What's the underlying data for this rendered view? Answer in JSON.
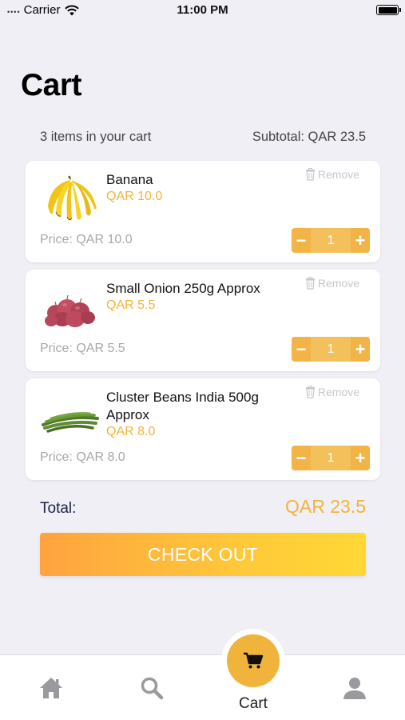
{
  "status_bar": {
    "carrier": "Carrier",
    "time": "11:00 PM",
    "signal": "••••"
  },
  "header": {
    "title": "Cart"
  },
  "summary": {
    "items_count": "3 items in your cart",
    "subtotal": "Subtotal: QAR 23.5"
  },
  "items": [
    {
      "name": "Banana",
      "price": "QAR 10.0",
      "price_label": "Price: QAR 10.0",
      "qty": "1",
      "remove": "Remove",
      "image": "banana-image"
    },
    {
      "name": "Small Onion 250g Approx",
      "price": "QAR 5.5",
      "price_label": "Price: QAR 5.5",
      "qty": "1",
      "remove": "Remove",
      "image": "onion-image"
    },
    {
      "name": "Cluster Beans India 500g Approx",
      "price": "QAR 8.0",
      "price_label": "Price: QAR 8.0",
      "qty": "1",
      "remove": "Remove",
      "image": "beans-image"
    }
  ],
  "total": {
    "label": "Total:",
    "value": "QAR 23.5"
  },
  "checkout": {
    "label": "CHECK OUT"
  },
  "tabs": {
    "home_icon": "home-icon",
    "search_icon": "search-icon",
    "cart_label": "Cart",
    "profile_icon": "profile-icon"
  },
  "colors": {
    "accent": "#f0b43c",
    "background": "#f0eff5"
  }
}
